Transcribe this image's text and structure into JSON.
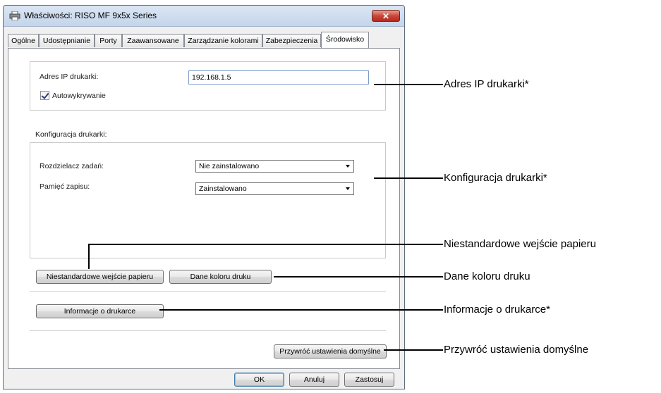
{
  "window": {
    "title": "Właściwości: RISO MF 9x5x Series",
    "close_glyph": "✕"
  },
  "tabs": [
    {
      "label": "Ogólne"
    },
    {
      "label": "Udostępnianie"
    },
    {
      "label": "Porty"
    },
    {
      "label": "Zaawansowane"
    },
    {
      "label": "Zarządzanie kolorami"
    },
    {
      "label": "Zabezpieczenia"
    },
    {
      "label": "Środowisko",
      "active": true
    }
  ],
  "ip_section": {
    "label": "Adres IP drukarki:",
    "value": "192.168.1.5",
    "auto_detect_label": "Autowykrywanie",
    "auto_detect_checked": true
  },
  "config_section": {
    "heading": "Konfiguracja drukarki:",
    "job_separator_label": "Rozdzielacz zadań:",
    "job_separator_value": "Nie zainstalowano",
    "storage_label": "Pamięć zapisu:",
    "storage_value": "Zainstalowano"
  },
  "buttons": {
    "custom_paper": "Niestandardowe wejście papieru",
    "color_data": "Dane koloru druku",
    "printer_info": "Informacje o drukarce",
    "restore_defaults": "Przywróć ustawienia domyślne",
    "ok": "OK",
    "cancel": "Anuluj",
    "apply": "Zastosuj"
  },
  "callouts": [
    "Adres IP drukarki*",
    "Konfiguracja drukarki*",
    "Niestandardowe wejście papieru",
    "Dane koloru druku",
    "Informacje o drukarce*",
    "Przywróć ustawienia domyślne"
  ]
}
